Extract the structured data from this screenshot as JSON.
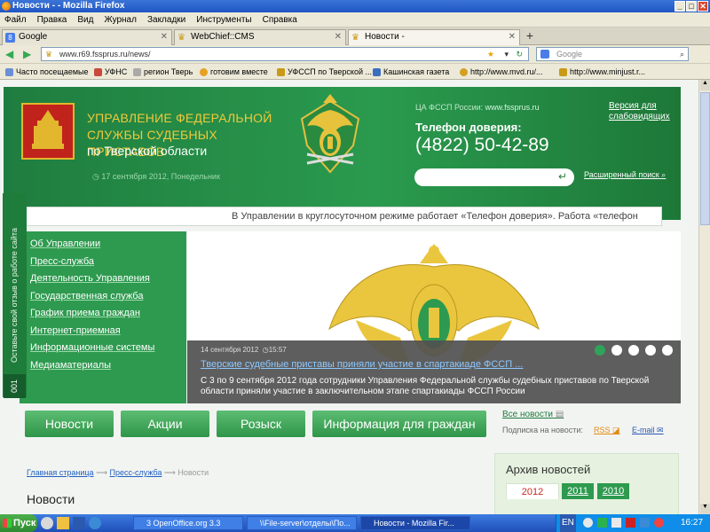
{
  "window": {
    "title": "Новости - - Mozilla Firefox"
  },
  "menu": [
    "Файл",
    "Правка",
    "Вид",
    "Журнал",
    "Закладки",
    "Инструменты",
    "Справка"
  ],
  "tabs": [
    {
      "label": "Google"
    },
    {
      "label": "WebChief::CMS"
    },
    {
      "label": "Новости -"
    }
  ],
  "nav": {
    "url": "www.r69.fssprus.ru/news/",
    "search_placeholder": "Google"
  },
  "bookmarks": [
    "Часто посещаемые",
    "УФНС",
    "регион Тверь",
    "готовим вместе",
    "УФССП по Тверской ...",
    "Кашинская газета",
    "http://www.mvd.ru/...",
    "http://www.minjust.r..."
  ],
  "header": {
    "org_line1": "УПРАВЛЕНИЕ ФЕДЕРАЛЬНОЙ",
    "org_line2": "СЛУЖБЫ СУДЕБНЫХ ПРИСТАВОВ",
    "region": "по Тверской области",
    "date": "17 сентября 2012, Понедельник",
    "ca_label": "ЦА ФССП России:",
    "ca_link": "www.fssprus.ru",
    "vision_line1": "Версия для",
    "vision_line2": "слабовидящих",
    "phone_label": "Телефон доверия:",
    "phone": "(4822) 50-42-89",
    "advanced_search": "Расширенный поиск"
  },
  "ticker": "В Управлении в круглосуточном режиме работает «Телефон доверия».   Работа «телефон",
  "feedback": "Оставьте свой отзыв о работе сайта",
  "feedback_num": "001",
  "left_menu": [
    "Об Управлении",
    "Пресс-служба",
    "Деятельность Управления",
    "Государственная служба",
    "График приема граждан",
    "Интернет-приемная",
    "Информационные системы",
    "Медиаматериалы"
  ],
  "slide": {
    "date": "14 сентября 2012",
    "time": "15:57",
    "title": "Тверские судебные приставы приняли участие в спартакиаде ФССП ...",
    "text": "С 3 по 9 сентября 2012 года сотрудники Управления Федеральной службы судебных приставов по Тверской области приняли участие в заключительном этапе спартакиады ФССП России"
  },
  "main_nav": [
    "Новости",
    "Акции",
    "Розыск",
    "Информация для граждан"
  ],
  "news_link": "Все новости",
  "subscribe": "Подписка на новости:",
  "rss": "RSS",
  "email": "E-mail",
  "breadcrumb": {
    "home": "Главная страница",
    "press": "Пресс-служба",
    "current": "Новости",
    "sep": "⟶"
  },
  "page_title": "Новости",
  "archive": {
    "title": "Архив новостей",
    "years": [
      "2012",
      "2011",
      "2010"
    ]
  },
  "taskbar": {
    "start": "Пуск",
    "tasks": [
      "3 OpenOffice.org 3.3",
      "\\\\File-server\\отделы\\По...",
      "Новости - Mozilla Fir..."
    ],
    "lang": "EN",
    "clock": "16:27"
  },
  "colors": {
    "brand_green": "#2a9a4e",
    "gold": "#f0c93a",
    "link_blue": "#2060c0"
  }
}
